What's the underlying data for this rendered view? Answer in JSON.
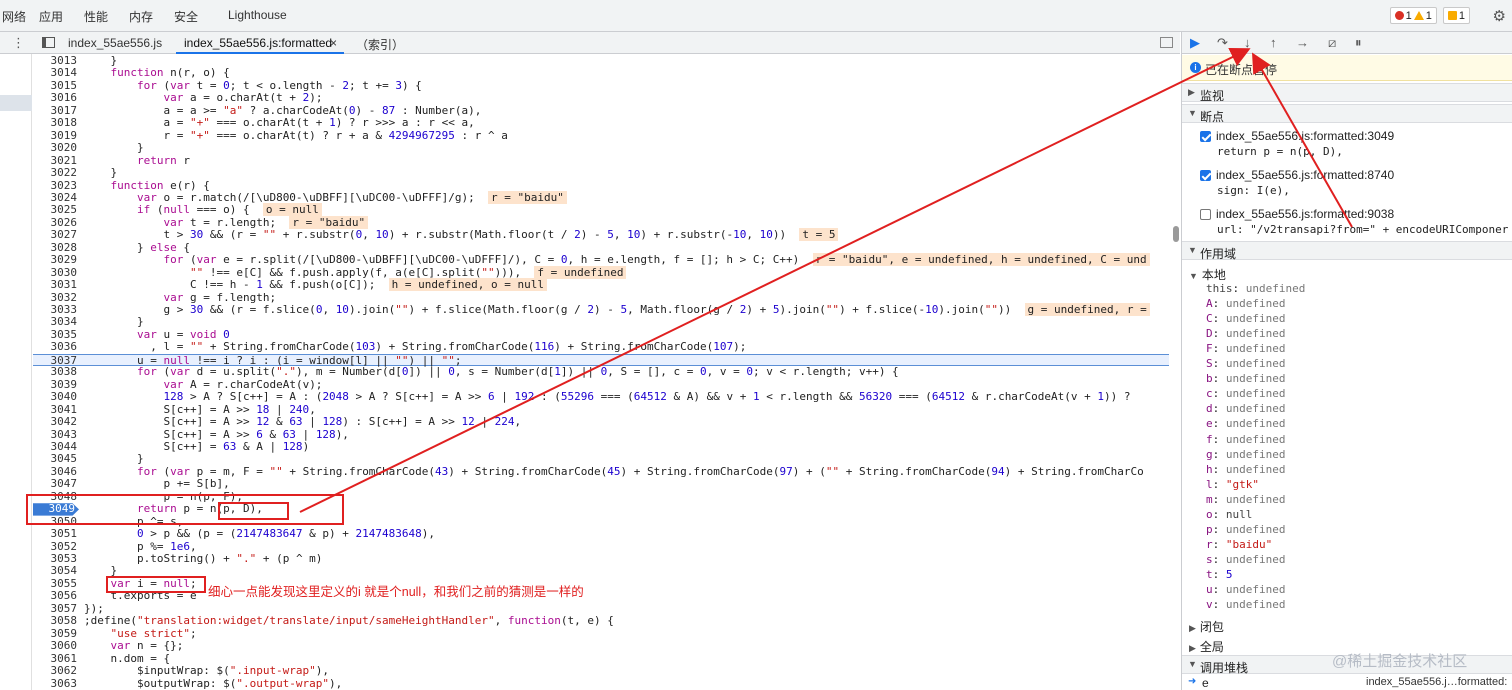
{
  "top_tabs": [
    "网络",
    "应用",
    "性能",
    "内存",
    "安全",
    "Lighthouse"
  ],
  "badges": [
    {
      "icon": "error-icon",
      "count": "1"
    },
    {
      "icon": "warning-icon",
      "count": "1"
    },
    {
      "icon": "issue-icon",
      "count": "1"
    }
  ],
  "file_tabs": [
    "index_55ae556.js",
    "index_55ae556.js:formatted",
    "（索引）"
  ],
  "file_tab_close": "×",
  "code_lines": [
    {
      "n": "3013",
      "t": "    }"
    },
    {
      "n": "3014",
      "t": "    function n(r, o) {"
    },
    {
      "n": "3015",
      "t": "        for (var t = 0; t < o.length - 2; t += 3) {"
    },
    {
      "n": "3016",
      "t": "            var a = o.charAt(t + 2);"
    },
    {
      "n": "3017",
      "t": "            a = a >= \"a\" ? a.charCodeAt(0) - 87 : Number(a),"
    },
    {
      "n": "3018",
      "t": "            a = \"+\" === o.charAt(t + 1) ? r >>> a : r << a,"
    },
    {
      "n": "3019",
      "t": "            r = \"+\" === o.charAt(t) ? r + a & 4294967295 : r ^ a"
    },
    {
      "n": "3020",
      "t": "        }"
    },
    {
      "n": "3021",
      "t": "        return r"
    },
    {
      "n": "3022",
      "t": "    }"
    },
    {
      "n": "3023",
      "t": "    function e(r) {"
    },
    {
      "n": "3024",
      "t": "        var o = r.match(/[\\uD800-\\uDBFF][\\uDC00-\\uDFFF]/g);",
      "a": "r = \"baidu\""
    },
    {
      "n": "3025",
      "t": "        if (null === o) {",
      "a": "o = null"
    },
    {
      "n": "3026",
      "t": "            var t = r.length;",
      "a": "r = \"baidu\""
    },
    {
      "n": "3027",
      "t": "            t > 30 && (r = \"\" + r.substr(0, 10) + r.substr(Math.floor(t / 2) - 5, 10) + r.substr(-10, 10))",
      "a": "t = 5"
    },
    {
      "n": "3028",
      "t": "        } else {"
    },
    {
      "n": "3029",
      "t": "            for (var e = r.split(/[\\uD800-\\uDBFF][\\uDC00-\\uDFFF]/), C = 0, h = e.length, f = []; h > C; C++)",
      "a": "r = \"baidu\", e = undefined, h = undefined, C = und"
    },
    {
      "n": "3030",
      "t": "                \"\" !== e[C] && f.push.apply(f, a(e[C].split(\"\"))),",
      "a": "f = undefined"
    },
    {
      "n": "3031",
      "t": "                C !== h - 1 && f.push(o[C]);",
      "a": "h = undefined, o = null"
    },
    {
      "n": "3032",
      "t": "            var g = f.length;"
    },
    {
      "n": "3033",
      "t": "            g > 30 && (r = f.slice(0, 10).join(\"\") + f.slice(Math.floor(g / 2) - 5, Math.floor(g / 2) + 5).join(\"\") + f.slice(-10).join(\"\"))",
      "a": "g = undefined, r ="
    },
    {
      "n": "3034",
      "t": "        }"
    },
    {
      "n": "3035",
      "t": "        var u = void 0"
    },
    {
      "n": "3036",
      "t": "          , l = \"\" + String.fromCharCode(103) + String.fromCharCode(116) + String.fromCharCode(107);"
    },
    {
      "n": "3037",
      "t": "        u = null !== i ? i : (i = window[l] || \"\") || \"\";"
    },
    {
      "n": "3038",
      "t": "        for (var d = u.split(\".\"), m = Number(d[0]) || 0, s = Number(d[1]) || 0, S = [], c = 0, v = 0; v < r.length; v++) {"
    },
    {
      "n": "3039",
      "t": "            var A = r.charCodeAt(v);"
    },
    {
      "n": "3040",
      "t": "            128 > A ? S[c++] = A : (2048 > A ? S[c++] = A >> 6 | 192 : (55296 === (64512 & A) && v + 1 < r.length && 56320 === (64512 & r.charCodeAt(v + 1)) ?"
    },
    {
      "n": "3041",
      "t": "            S[c++] = A >> 18 | 240,"
    },
    {
      "n": "3042",
      "t": "            S[c++] = A >> 12 & 63 | 128) : S[c++] = A >> 12 | 224,"
    },
    {
      "n": "3043",
      "t": "            S[c++] = A >> 6 & 63 | 128),"
    },
    {
      "n": "3044",
      "t": "            S[c++] = 63 & A | 128)"
    },
    {
      "n": "3045",
      "t": "        }"
    },
    {
      "n": "3046",
      "t": "        for (var p = m, F = \"\" + String.fromCharCode(43) + String.fromCharCode(45) + String.fromCharCode(97) + (\"\" + String.fromCharCode(94) + String.fromCharCo"
    },
    {
      "n": "3047",
      "t": "            p += S[b],"
    },
    {
      "n": "3048",
      "t": "            p = n(p, F);"
    },
    {
      "n": "3049",
      "t": "        return p = n(p, D),"
    },
    {
      "n": "3050",
      "t": "        p ^= s,"
    },
    {
      "n": "3051",
      "t": "        0 > p && (p = (2147483647 & p) + 2147483648),"
    },
    {
      "n": "3052",
      "t": "        p %= 1e6,"
    },
    {
      "n": "3053",
      "t": "        p.toString() + \".\" + (p ^ m)"
    },
    {
      "n": "3054",
      "t": "    }"
    },
    {
      "n": "3055",
      "t": "    var i = null;"
    },
    {
      "n": "3056",
      "t": "    t.exports = e"
    },
    {
      "n": "3057",
      "t": "});"
    },
    {
      "n": "3058",
      "t": ";define(\"translation:widget/translate/input/sameHeightHandler\", function(t, e) {"
    },
    {
      "n": "3059",
      "t": "    \"use strict\";"
    },
    {
      "n": "3060",
      "t": "    var n = {};"
    },
    {
      "n": "3061",
      "t": "    n.dom = {"
    },
    {
      "n": "3062",
      "t": "        $inputWrap: $(\".input-wrap\"),"
    },
    {
      "n": "3063",
      "t": "        $outputWrap: $(\".output-wrap\"),"
    }
  ],
  "annotation_note": "细心一点能发现这里定义的i 就是个null，和我们之前的猜测是一样的",
  "debugger": {
    "paused_message": "已在断点暂停",
    "sections": {
      "watch": "监视",
      "breakpoints": "断点",
      "scope": "作用域",
      "closure": "闭包",
      "global": "全局",
      "call_stack": "调用堆栈"
    },
    "breakpoints": [
      {
        "file": "index_55ae556.js:formatted:3049",
        "code": "return p = n(p, D),",
        "checked": true
      },
      {
        "file": "index_55ae556.js:formatted:8740",
        "code": "sign: I(e),",
        "checked": true
      },
      {
        "file": "index_55ae556.js:formatted:9038",
        "code": "url: \"/v2transapi?from=\" + encodeURIComponer",
        "checked": false
      }
    ],
    "scope_local_label": "本地",
    "scope_vars": [
      {
        "k": "this",
        "v": "undefined",
        "kind": "undef",
        "plain": true
      },
      {
        "k": "A",
        "v": "undefined",
        "kind": "undef"
      },
      {
        "k": "C",
        "v": "undefined",
        "kind": "undef"
      },
      {
        "k": "D",
        "v": "undefined",
        "kind": "undef"
      },
      {
        "k": "F",
        "v": "undefined",
        "kind": "undef"
      },
      {
        "k": "S",
        "v": "undefined",
        "kind": "undef"
      },
      {
        "k": "b",
        "v": "undefined",
        "kind": "undef"
      },
      {
        "k": "c",
        "v": "undefined",
        "kind": "undef"
      },
      {
        "k": "d",
        "v": "undefined",
        "kind": "undef"
      },
      {
        "k": "e",
        "v": "undefined",
        "kind": "undef"
      },
      {
        "k": "f",
        "v": "undefined",
        "kind": "undef"
      },
      {
        "k": "g",
        "v": "undefined",
        "kind": "undef"
      },
      {
        "k": "h",
        "v": "undefined",
        "kind": "undef"
      },
      {
        "k": "l",
        "v": "\"gtk\"",
        "kind": "str"
      },
      {
        "k": "m",
        "v": "undefined",
        "kind": "undef"
      },
      {
        "k": "o",
        "v": "null",
        "kind": "null"
      },
      {
        "k": "p",
        "v": "undefined",
        "kind": "undef"
      },
      {
        "k": "r",
        "v": "\"baidu\"",
        "kind": "str"
      },
      {
        "k": "s",
        "v": "undefined",
        "kind": "undef"
      },
      {
        "k": "t",
        "v": "5",
        "kind": "num"
      },
      {
        "k": "u",
        "v": "undefined",
        "kind": "undef"
      },
      {
        "k": "v",
        "v": "undefined",
        "kind": "undef"
      }
    ],
    "call_stack_top": {
      "fn": "e",
      "loc": "index_55ae556.j…formatted:"
    }
  },
  "watermark": "@稀土掘金技术社区",
  "colors": {
    "accent": "#1a73e8",
    "annotation_red": "#e02020",
    "scope_annotation": "#fde3cc"
  }
}
